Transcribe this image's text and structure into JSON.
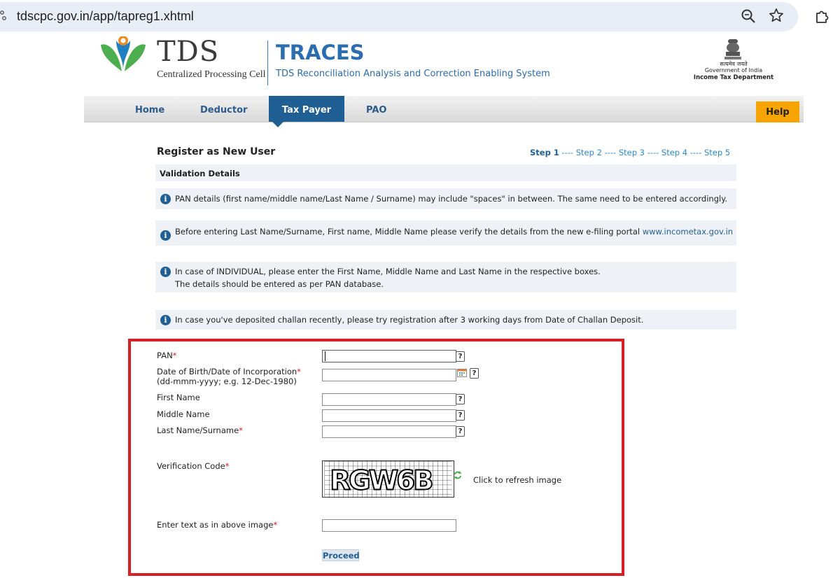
{
  "browser": {
    "url": "tdscpc.gov.in/app/tapreg1.xhtml"
  },
  "header": {
    "logo_text": "TDS",
    "logo_subtext": "Centralized Processing Cell",
    "title": "TRACES",
    "subtitle": "TDS Reconciliation Analysis and Correction Enabling System",
    "gov_hindi": "सत्यमेव जयते",
    "gov_line1": "Government of India",
    "gov_line2": "Income Tax Department"
  },
  "nav": {
    "items": [
      {
        "label": "Home"
      },
      {
        "label": "Deductor"
      },
      {
        "label": "Tax Payer"
      },
      {
        "label": "PAO"
      }
    ],
    "active": "Tax Payer",
    "help_label": "Help"
  },
  "colors": {
    "brand_blue": "#1f5f94",
    "help_orange": "#f7a400",
    "required_red": "#d81f26"
  },
  "page": {
    "title": "Register as New User",
    "steps": [
      "Step 1",
      "Step 2",
      "Step 3",
      "Step 4",
      "Step 5"
    ],
    "step_separator": "----",
    "current_step": "Step 1",
    "section_title": "Validation Details"
  },
  "notes": [
    {
      "text": "PAN details (first name/middle name/Last Name / Surname) may include \"spaces\" in between. The same need to be entered accordingly."
    },
    {
      "text": "Before entering Last Name/Surname, First name, Middle Name please verify the details from the new e-filing portal ",
      "link": "www.incometax.gov.in"
    },
    {
      "text": "In case of INDIVIDUAL, please enter the First Name, Middle Name and Last Name in the respective boxes.",
      "text2": "The details should be entered as per PAN database."
    },
    {
      "text": "In case you've deposited challan recently, please try registration after 3 working days from Date of Challan Deposit."
    }
  ],
  "form": {
    "pan_label": "PAN",
    "dob_label": "Date of Birth/Date of Incorporation",
    "dob_hint": "(dd-mmm-yyyy; e.g. 12-Dec-1980)",
    "first_name_label": "First Name",
    "middle_name_label": "Middle Name",
    "last_name_label": "Last Name/Surname",
    "verification_label": "Verification Code",
    "captcha_text": "RGW6B",
    "refresh_label": "Click to refresh image",
    "enter_text_label": "Enter text as in above image",
    "required_mark": "*",
    "help_mark": "?",
    "proceed_label": "Proceed"
  }
}
